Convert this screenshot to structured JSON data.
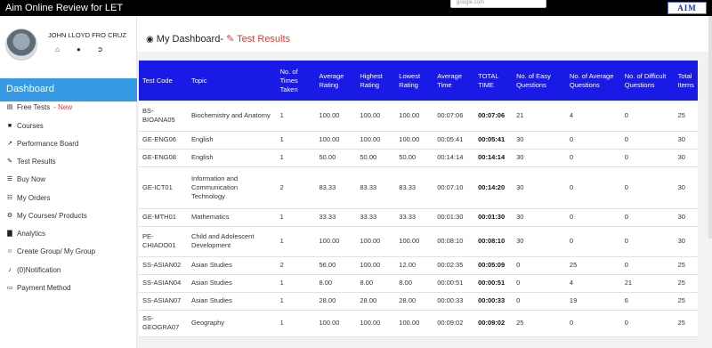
{
  "app": {
    "title": "Aim Online Review for LET",
    "url_text": "google.com",
    "logo_text": "AIM"
  },
  "user": {
    "name": "JOHN LLOYD FRO CRUZ",
    "icons": [
      "home-icon",
      "user-icon",
      "logout-icon"
    ]
  },
  "sidebar": {
    "active": "Dashboard",
    "items": [
      {
        "label": "Free Tests",
        "badge": "- New",
        "icon": "clipboard-icon"
      },
      {
        "label": "Courses",
        "icon": "folder-icon"
      },
      {
        "label": "Performance Board",
        "icon": "line-chart-icon"
      },
      {
        "label": "Test Results",
        "icon": "pencil-icon"
      },
      {
        "label": "Buy Now",
        "icon": "cart-icon"
      },
      {
        "label": "My Orders",
        "icon": "sitemap-icon"
      },
      {
        "label": "My Courses/ Products",
        "icon": "gear-icon"
      },
      {
        "label": "Analytics",
        "icon": "bar-chart-icon"
      },
      {
        "label": "Create Group/ My Group",
        "icon": "users-icon"
      },
      {
        "label": "(0)Notification",
        "icon": "bell-icon"
      },
      {
        "label": "Payment Method",
        "icon": "credit-card-icon"
      }
    ]
  },
  "header": {
    "title": "My Dashboard-",
    "link": "Test Results"
  },
  "table": {
    "columns": [
      "Test Code",
      "Topic",
      "No. of Times Taken",
      "Average Rating",
      "Highest Rating",
      "Lowest Rating",
      "Average Time",
      "TOTAL TIME",
      "No. of Easy Questions",
      "No. of Average Questions",
      "No. of Difficult Questions",
      "Total Items"
    ],
    "rows": [
      [
        "BS-BIOANA05",
        "Biochemistry and Anatomy",
        "1",
        "100.00",
        "100.00",
        "100.00",
        "00:07:06",
        "00:07:06",
        "21",
        "4",
        "0",
        "25"
      ],
      [
        "GE-ENG06",
        "English",
        "1",
        "100.00",
        "100.00",
        "100.00",
        "00:05:41",
        "00:05:41",
        "30",
        "0",
        "0",
        "30"
      ],
      [
        "GE-ENG08",
        "English",
        "1",
        "50.00",
        "50.00",
        "50.00",
        "00:14:14",
        "00:14:14",
        "30",
        "0",
        "0",
        "30"
      ],
      [
        "GE-ICT01",
        "Information and Communication Technology",
        "2",
        "83.33",
        "83.33",
        "83.33",
        "00:07:10",
        "00:14:20",
        "30",
        "0",
        "0",
        "30"
      ],
      [
        "GE-MTH01",
        "Mathematics",
        "1",
        "33.33",
        "33.33",
        "33.33",
        "00:01:30",
        "00:01:30",
        "30",
        "0",
        "0",
        "30"
      ],
      [
        "PE-CHIADO01",
        "Child and Adolescent Development",
        "1",
        "100.00",
        "100.00",
        "100.00",
        "00:08:10",
        "00:08:10",
        "30",
        "0",
        "0",
        "30"
      ],
      [
        "SS-ASIAN02",
        "Asian Studies",
        "2",
        "56.00",
        "100.00",
        "12.00",
        "00:02:35",
        "00:05:09",
        "0",
        "25",
        "0",
        "25"
      ],
      [
        "SS-ASIAN04",
        "Asian Studies",
        "1",
        "8.00",
        "8.00",
        "8.00",
        "00:00:51",
        "00:00:51",
        "0",
        "4",
        "21",
        "25"
      ],
      [
        "SS-ASIAN07",
        "Asian Studies",
        "1",
        "28.00",
        "28.00",
        "28.00",
        "00:00:33",
        "00:00:33",
        "0",
        "19",
        "6",
        "25"
      ],
      [
        "SS-GEOGRA07",
        "Geography",
        "1",
        "100.00",
        "100.00",
        "100.00",
        "00:09:02",
        "00:09:02",
        "25",
        "0",
        "0",
        "25"
      ]
    ]
  },
  "colors": {
    "accent": "#3699e6",
    "header_blue": "#1a1ae6",
    "new_badge": "#e53935",
    "topbar": "#000000"
  }
}
